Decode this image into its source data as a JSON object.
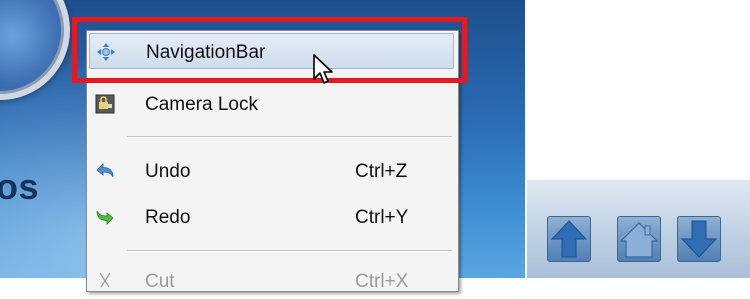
{
  "context_menu": {
    "items": [
      {
        "label": "NavigationBar",
        "shortcut": "",
        "icon": "navigation-icon",
        "hovered": true,
        "disabled": false
      },
      {
        "label": "Camera Lock",
        "shortcut": "",
        "icon": "camera-lock-icon",
        "hovered": false,
        "disabled": false
      },
      {
        "label": "Undo",
        "shortcut": "Ctrl+Z",
        "icon": "undo-icon",
        "hovered": false,
        "disabled": false
      },
      {
        "label": "Redo",
        "shortcut": "Ctrl+Y",
        "icon": "redo-icon",
        "hovered": false,
        "disabled": false
      },
      {
        "label": "Cut",
        "shortcut": "Ctrl+X",
        "icon": "cut-icon",
        "hovered": false,
        "disabled": true
      }
    ]
  },
  "background": {
    "partial_text": "os"
  },
  "nav_toolbar": {
    "buttons": [
      "arrow-up-icon",
      "home-icon",
      "arrow-down-icon"
    ]
  },
  "colors": {
    "highlight": "#e01b24",
    "accent": "#2f6db5"
  }
}
